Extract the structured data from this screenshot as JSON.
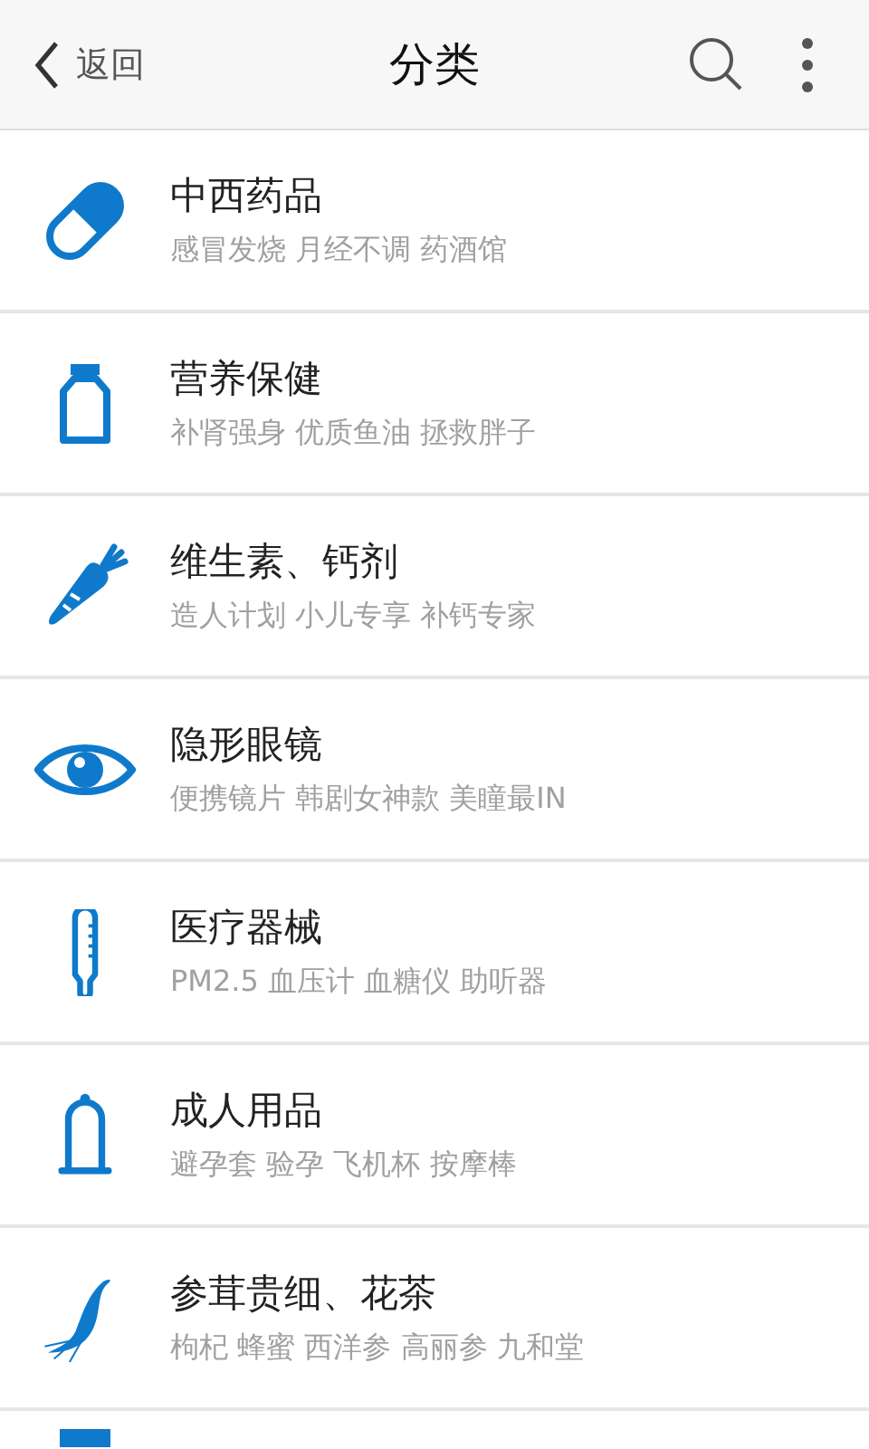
{
  "header": {
    "back_label": "返回",
    "title": "分类"
  },
  "categories": [
    {
      "title": "中西药品",
      "subtitle": "感冒发烧 月经不调 药酒馆"
    },
    {
      "title": "营养保健",
      "subtitle": "补肾强身 优质鱼油 拯救胖子"
    },
    {
      "title": "维生素、钙剂",
      "subtitle": "造人计划 小儿专享 补钙专家"
    },
    {
      "title": "隐形眼镜",
      "subtitle": "便携镜片 韩剧女神款 美瞳最IN"
    },
    {
      "title": "医疗器械",
      "subtitle": "PM2.5 血压计 血糖仪 助听器"
    },
    {
      "title": "成人用品",
      "subtitle": "避孕套 验孕 飞机杯 按摩棒"
    },
    {
      "title": "参茸贵细、花茶",
      "subtitle": "枸杞 蜂蜜 西洋参 高丽参 九和堂"
    }
  ]
}
